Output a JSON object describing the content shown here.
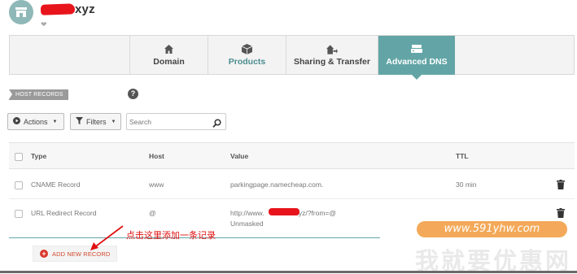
{
  "header": {
    "domain_name": "xyz"
  },
  "tabs": [
    {
      "label": "Domain",
      "icon": "home-icon"
    },
    {
      "label": "Products",
      "icon": "box-icon"
    },
    {
      "label": "Sharing & Transfer",
      "icon": "house-arrow-icon"
    },
    {
      "label": "Advanced DNS",
      "icon": "server-stack-icon",
      "active": true
    }
  ],
  "section": {
    "title": "HOST RECORDS",
    "help": "?"
  },
  "toolbar": {
    "actions_label": "Actions",
    "filters_label": "Filters",
    "search_placeholder": "Search"
  },
  "table": {
    "columns": {
      "type": "Type",
      "host": "Host",
      "value": "Value",
      "ttl": "TTL"
    },
    "rows": [
      {
        "type": "CNAME Record",
        "host": "www",
        "value": "parkingpage.namecheap.com.",
        "ttl": "30 min"
      },
      {
        "type": "URL Redirect Record",
        "host": "@",
        "value": "http://www.",
        "value_suffix": "xyz/?from=@",
        "value_note": "Unmasked",
        "ttl": ""
      }
    ]
  },
  "add_record": {
    "label": "ADD NEW RECORD"
  },
  "annotation": {
    "text": "点击这里添加一条记录"
  },
  "watermark": {
    "url": "www.591yhw.com",
    "slogan": "我就要优惠网"
  },
  "colors": {
    "accent": "#63a5a6",
    "add_button": "#d9362b",
    "annotation": "#e01010"
  }
}
